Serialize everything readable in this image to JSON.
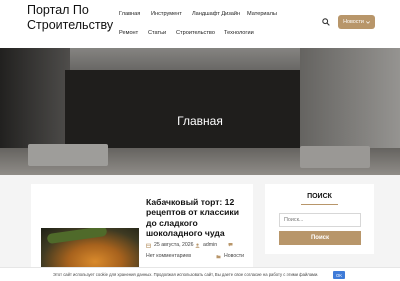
{
  "header": {
    "site_title": "Портал По Строительству",
    "nav": [
      {
        "label": "Главная"
      },
      {
        "label": "Инструмент"
      },
      {
        "label": "Ландшафт Дизайн"
      },
      {
        "label": "Материалы"
      },
      {
        "label": "Ремонт"
      },
      {
        "label": "Статьи"
      },
      {
        "label": "Строительство"
      },
      {
        "label": "Технологии"
      }
    ],
    "search_icon": "search-icon",
    "news_button": {
      "label": "Новости",
      "icon": "chevron-down-icon"
    }
  },
  "hero": {
    "title": "Главная"
  },
  "post": {
    "title": "Кабачковый торт: 12 рецептов от классики до сладкого шоколадного чуда",
    "date": "25 августа, 2026",
    "author": "admin",
    "comments": "Нет комментариев",
    "category": "Новости"
  },
  "sidebar": {
    "search_title": "ПОИСК",
    "search_placeholder": "Поиск...",
    "search_button": "Поиск"
  },
  "cookie": {
    "text": "Этот сайт использует cookie для хранения данных. Продолжая использовать сайт, Вы даете свое согласие на работу с этими файлами.",
    "ok_label": "OK"
  },
  "colors": {
    "accent": "#b8966a",
    "cookie_button": "#3f7bd8"
  }
}
